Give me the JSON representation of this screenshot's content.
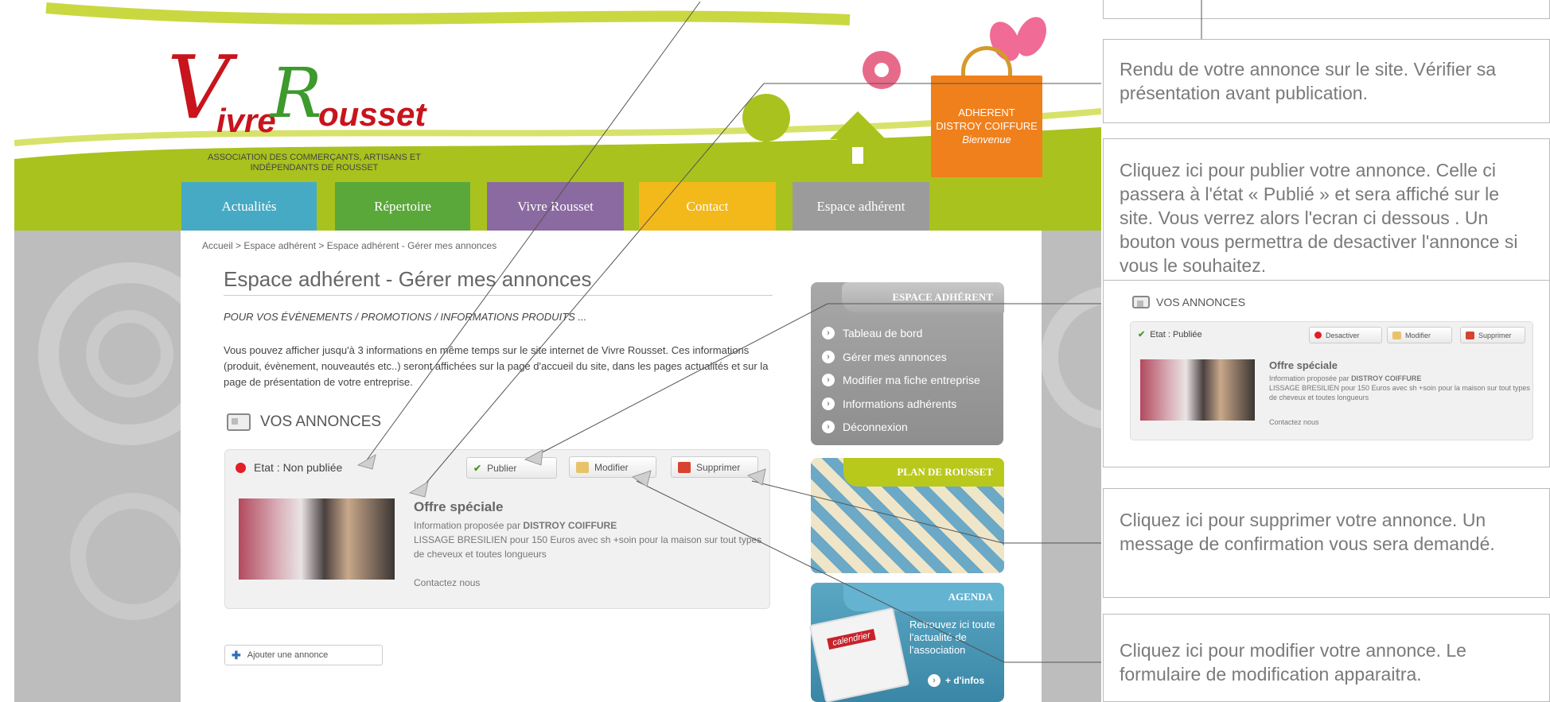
{
  "logo": {
    "v": "V",
    "ivre": "ivre",
    "r": "R",
    "ousset": "ousset",
    "subtitle": "ASSOCIATION DES COMMERÇANTS, ARTISANS ET INDÉPENDANTS DE ROUSSET"
  },
  "member_badge": {
    "line1": "ADHERENT",
    "line2": "DISTROY COIFFURE",
    "line3": "Bienvenue"
  },
  "nav": {
    "tabs": [
      {
        "label": "Actualités",
        "color": "#46aac4"
      },
      {
        "label": "Répertoire",
        "color": "#5aa83a"
      },
      {
        "label": "Vivre Rousset",
        "color": "#8a6aa0"
      },
      {
        "label": "Contact",
        "color": "#f3b81a"
      },
      {
        "label": "Espace adhérent",
        "color": "#9b9b9b"
      }
    ]
  },
  "breadcrumb": "Accueil  > Espace adhérent  > Espace adhérent - Gérer mes annonces",
  "page_title": "Espace adhérent - Gérer mes annonces",
  "intro": "POUR VOS ÉVÈNEMENTS / PROMOTIONS / INFORMATIONS PRODUITS ...",
  "description": "Vous pouvez afficher jusqu'à 3 informations en même temps sur le site internet de Vivre Rousset. Ces informations (produit, évènement, nouveautés etc..) seront affichées sur la page d'accueil du site, dans les pages actualités et sur la page de présentation de votre entreprise.",
  "section_title": "VOS ANNONCES",
  "annonce": {
    "status": "Etat : Non publiée",
    "publish": "Publier",
    "modify": "Modifier",
    "delete": "Supprimer",
    "title": "Offre spéciale",
    "proposed_prefix": "Information proposée par ",
    "company": "DISTROY COIFFURE",
    "text": "LISSAGE BRESILIEN pour 150 Euros avec sh +soin pour la maison sur tout types de cheveux et toutes longueurs",
    "contact": "Contactez nous"
  },
  "add_button": "Ajouter une annonce",
  "sidebar": {
    "title": "ESPACE ADHÉRENT",
    "items": [
      "Tableau de bord",
      "Gérer mes annonces",
      "Modifier ma fiche entreprise",
      "Informations adhérents",
      "Déconnexion"
    ]
  },
  "plan": {
    "title": "PLAN DE ROUSSET"
  },
  "agenda": {
    "title": "AGENDA",
    "calendar_label": "calendrier",
    "text": "Retrouvez ici toute l'actualité de l'association",
    "more": "+ d'infos"
  },
  "annotations": {
    "render": "Rendu de votre annonce sur le site. Vérifier sa présentation avant publication.",
    "publish": "Cliquez ici pour publier votre annonce. Celle ci passera à l'état « Publié » et sera affiché sur le site. Vous verrez alors l'ecran ci dessous . Un bouton vous permettra de desactiver l'annonce si vous le souhaitez.",
    "delete": "Cliquez ici pour supprimer votre annonce. Un message de confirmation vous sera demandé.",
    "modify": "Cliquez ici pour modifier votre annonce. Le formulaire de modification apparaitra."
  },
  "published_preview": {
    "title": "VOS ANNONCES",
    "status": "Etat : Publiée",
    "deactivate": "Desactiver",
    "modify": "Modifier",
    "delete": "Supprimer",
    "offer_title": "Offre spéciale",
    "proposed_prefix": "Information proposée par ",
    "company": "DISTROY COIFFURE",
    "text": "LISSAGE BRESILIEN pour 150 Euros avec sh +soin pour la maison sur tout types de cheveux et toutes longueurs",
    "contact": "Contactez nous"
  }
}
